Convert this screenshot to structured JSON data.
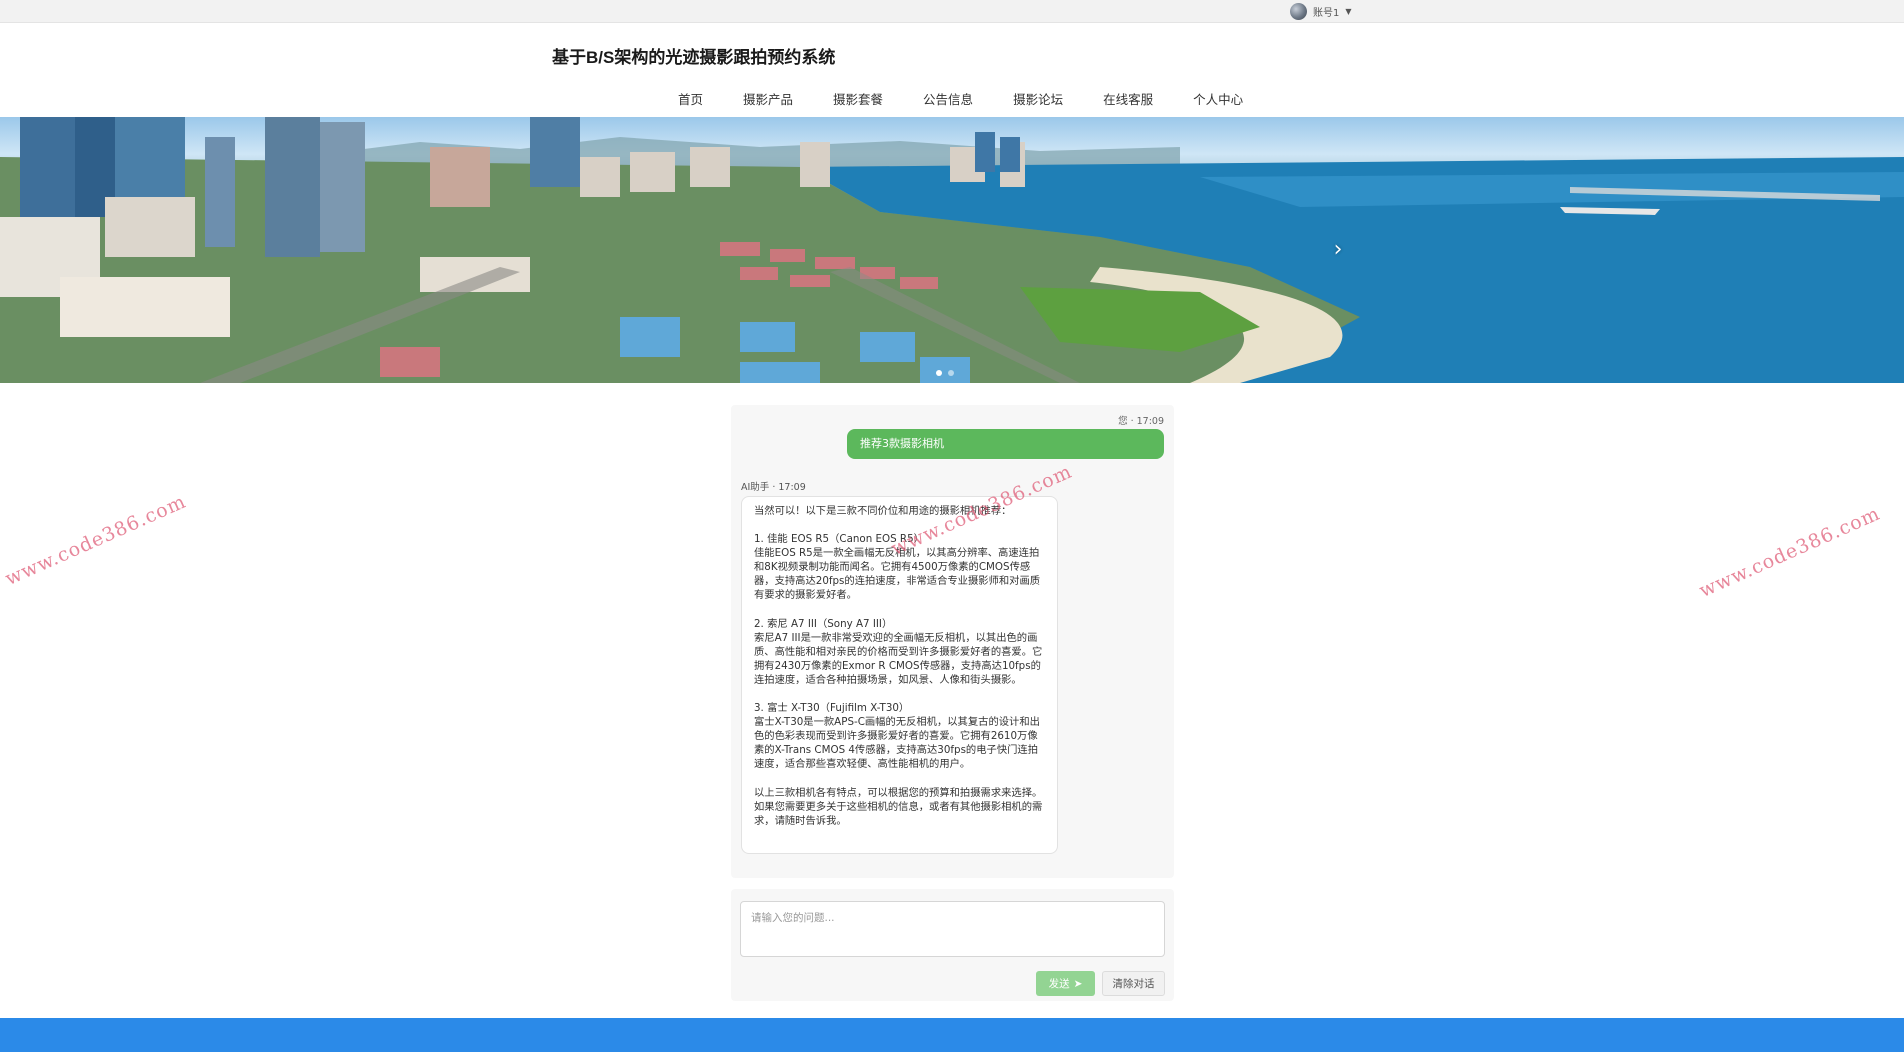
{
  "header": {
    "account_label": "账号1",
    "site_title": "基于B/S架构的光迹摄影跟拍预约系统"
  },
  "nav": {
    "items": [
      {
        "label": "首页"
      },
      {
        "label": "摄影产品"
      },
      {
        "label": "摄影套餐"
      },
      {
        "label": "公告信息"
      },
      {
        "label": "摄影论坛"
      },
      {
        "label": "在线客服"
      },
      {
        "label": "个人中心"
      }
    ]
  },
  "banner": {
    "next_icon": "chevron-right-icon"
  },
  "chat": {
    "user_meta": "您 · 17:09",
    "user_message": "推荐3款摄影相机",
    "ai_meta": "AI助手 · 17:09",
    "ai_paragraphs": [
      "当然可以！以下是三款不同价位和用途的摄影相机推荐：",
      "1. 佳能 EOS R5（Canon EOS R5）\n佳能EOS R5是一款全画幅无反相机，以其高分辨率、高速连拍和8K视频录制功能而闻名。它拥有4500万像素的CMOS传感器，支持高达20fps的连拍速度，非常适合专业摄影师和对画质有要求的摄影爱好者。",
      "2. 索尼 A7 III（Sony A7 III）\n索尼A7 III是一款非常受欢迎的全画幅无反相机，以其出色的画质、高性能和相对亲民的价格而受到许多摄影爱好者的喜爱。它拥有2430万像素的Exmor R CMOS传感器，支持高达10fps的连拍速度，适合各种拍摄场景，如风景、人像和街头摄影。",
      "3. 富士 X-T30（Fujifilm X-T30）\n富士X-T30是一款APS-C画幅的无反相机，以其复古的设计和出色的色彩表现而受到许多摄影爱好者的喜爱。它拥有2610万像素的X-Trans CMOS 4传感器，支持高达30fps的电子快门连拍速度，适合那些喜欢轻便、高性能相机的用户。",
      "以上三款相机各有特点，可以根据您的预算和拍摄需求来选择。如果您需要更多关于这些相机的信息，或者有其他摄影相机的需求，请随时告诉我。"
    ],
    "input_placeholder": "请输入您的问题...",
    "send_label": "发送",
    "clear_label": "清除对话"
  },
  "watermark": {
    "text": "www.code386.com"
  },
  "colors": {
    "user_bubble": "#5cb85c",
    "send_button": "#93d493",
    "footer": "#2b8ae8",
    "watermark": "#e0607a"
  }
}
